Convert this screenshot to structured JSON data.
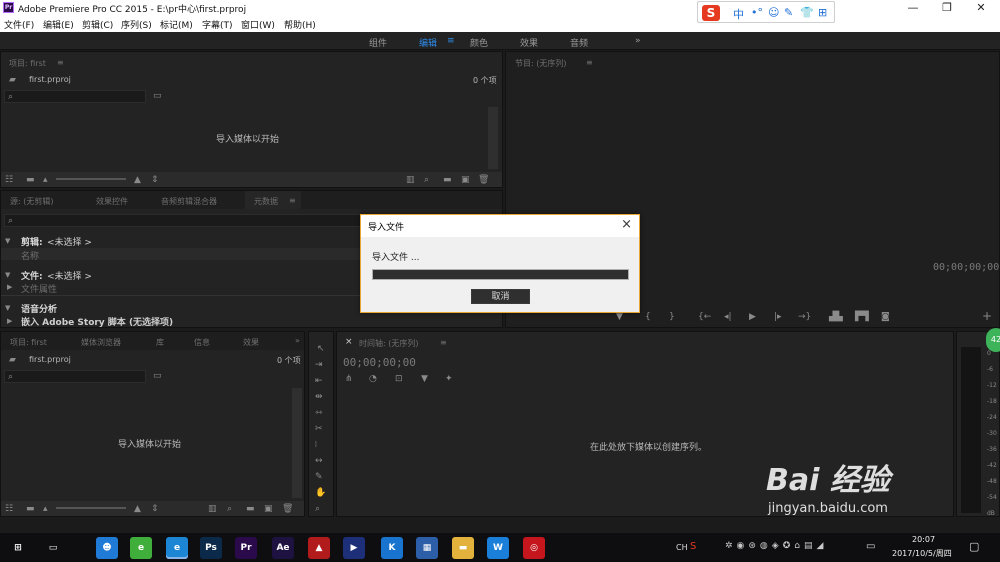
{
  "app": {
    "title": "Adobe Premiere Pro CC 2015 - E:\\pr中心\\first.prproj",
    "icon_label": "Pr",
    "window_controls": [
      "minimize-icon",
      "maximize-icon",
      "close-icon"
    ]
  },
  "menu": [
    "文件(F)",
    "编辑(E)",
    "剪辑(C)",
    "序列(S)",
    "标记(M)",
    "字幕(T)",
    "窗口(W)",
    "帮助(H)"
  ],
  "ime": {
    "logo": "S",
    "lang": "中",
    "glyphs": [
      "•°",
      "☺",
      "✎",
      "👕",
      "⊞"
    ]
  },
  "workspaces": {
    "items": [
      "组件",
      "编辑",
      "颜色",
      "效果",
      "音频"
    ],
    "active": "编辑",
    "more": "»"
  },
  "project_panel": {
    "title": "项目: first",
    "file": "first.prproj",
    "count": "0 个项",
    "empty_text": "导入媒体以开始"
  },
  "program_monitor": {
    "title": "节目: (无序列)",
    "timecode": "00;00;00;00"
  },
  "source_panel": {
    "tabs": [
      "源: (无剪辑)",
      "效果控件",
      "音频剪辑混合器",
      "元数据"
    ],
    "clip_label": "剪辑:",
    "clip_value": "<未选择 >",
    "name_label": "名称",
    "file_label": "文件:",
    "file_value": "<未选择 >",
    "file_props": "文件属性",
    "speech": "语音分析",
    "embed": "嵌入 Adobe Story 脚本 (无选择项)"
  },
  "dialog": {
    "title": "导入文件",
    "message": "导入文件 ...",
    "progress": 0,
    "cancel": "取消",
    "close": "×"
  },
  "bottom_project": {
    "tabs": [
      "项目: first",
      "媒体浏览器",
      "库",
      "信息",
      "效果"
    ],
    "file": "first.prproj",
    "count": "0 个项",
    "empty_text": "导入媒体以开始"
  },
  "timeline": {
    "title": "时间轴: (无序列)",
    "timecode": "00;00;00;00",
    "empty_text": "在此处放下媒体以创建序列。"
  },
  "audio_meter": {
    "labels": [
      "0",
      "-6",
      "-12",
      "-18",
      "-24",
      "-30",
      "-36",
      "-42",
      "-48",
      "-54",
      "dB"
    ],
    "badge": "42"
  },
  "taskbar": {
    "apps": [
      {
        "name": "start",
        "label": "⊞",
        "color": "#0e0e10"
      },
      {
        "name": "taskview",
        "label": "▭",
        "color": "#0e0e10"
      },
      {
        "name": "app-blue",
        "label": "☻",
        "color": "#1f7bd6"
      },
      {
        "name": "app-green",
        "label": "e",
        "color": "#3fae3a"
      },
      {
        "name": "ie",
        "label": "e",
        "color": "#1c86d4"
      },
      {
        "name": "photoshop",
        "label": "Ps",
        "color": "#0b2a4a"
      },
      {
        "name": "premiere",
        "label": "Pr",
        "color": "#2a0a4a"
      },
      {
        "name": "aftereffects",
        "label": "Ae",
        "color": "#1e1240"
      },
      {
        "name": "acrobat",
        "label": "▲",
        "color": "#b21b1b"
      },
      {
        "name": "media",
        "label": "▶",
        "color": "#1e2f7a"
      },
      {
        "name": "kugou",
        "label": "K",
        "color": "#1874cf"
      },
      {
        "name": "calc",
        "label": "▦",
        "color": "#2d5ea8"
      },
      {
        "name": "folder",
        "label": "▬",
        "color": "#e3b23c"
      },
      {
        "name": "wps",
        "label": "W",
        "color": "#1a7fd8"
      },
      {
        "name": "cc",
        "label": "◎",
        "color": "#c4161c"
      }
    ],
    "tray_lang": "CH",
    "time": "20:07",
    "date": "2017/10/5/周四"
  },
  "watermark": {
    "brand": "Bai  经验",
    "url": "jingyan.baidu.com"
  }
}
